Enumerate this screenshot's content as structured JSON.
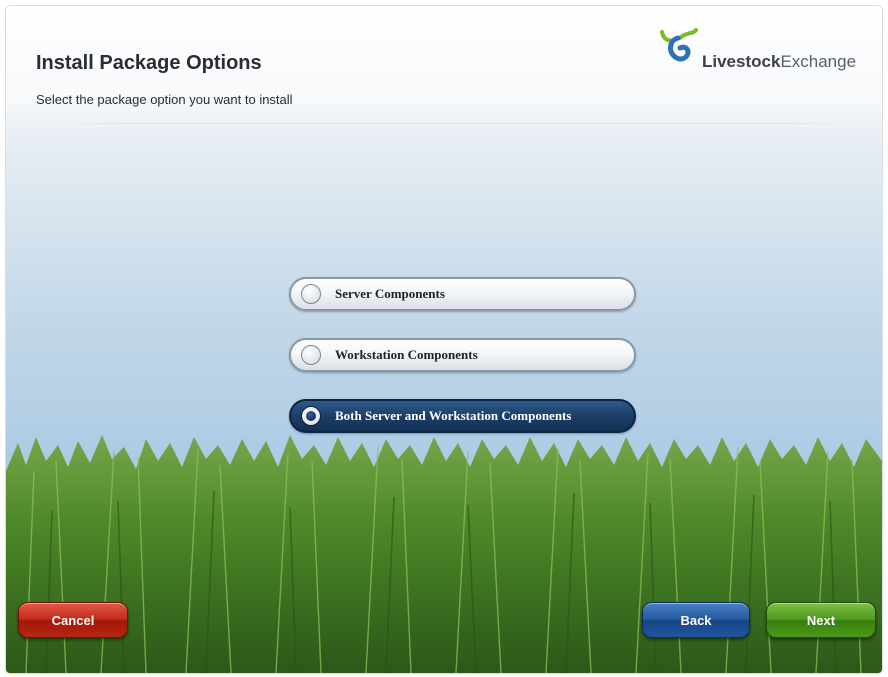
{
  "header": {
    "title": "Install Package Options",
    "subtitle": "Select the package option you want to install"
  },
  "logo": {
    "bold": "Livestock",
    "light": "Exchange",
    "icon": "livestock-exchange-logo-icon",
    "colors": {
      "green": "#7cb829",
      "blue": "#2d72b8"
    }
  },
  "options": [
    {
      "label": "Server Components",
      "selected": false
    },
    {
      "label": "Workstation Components",
      "selected": false
    },
    {
      "label": "Both Server and Workstation Components",
      "selected": true
    }
  ],
  "buttons": {
    "cancel": "Cancel",
    "back": "Back",
    "next": "Next"
  },
  "colors": {
    "cancel": "#c42a19",
    "back": "#245aa0",
    "next": "#4c9a1c",
    "selected_option": "#1c3f68"
  }
}
